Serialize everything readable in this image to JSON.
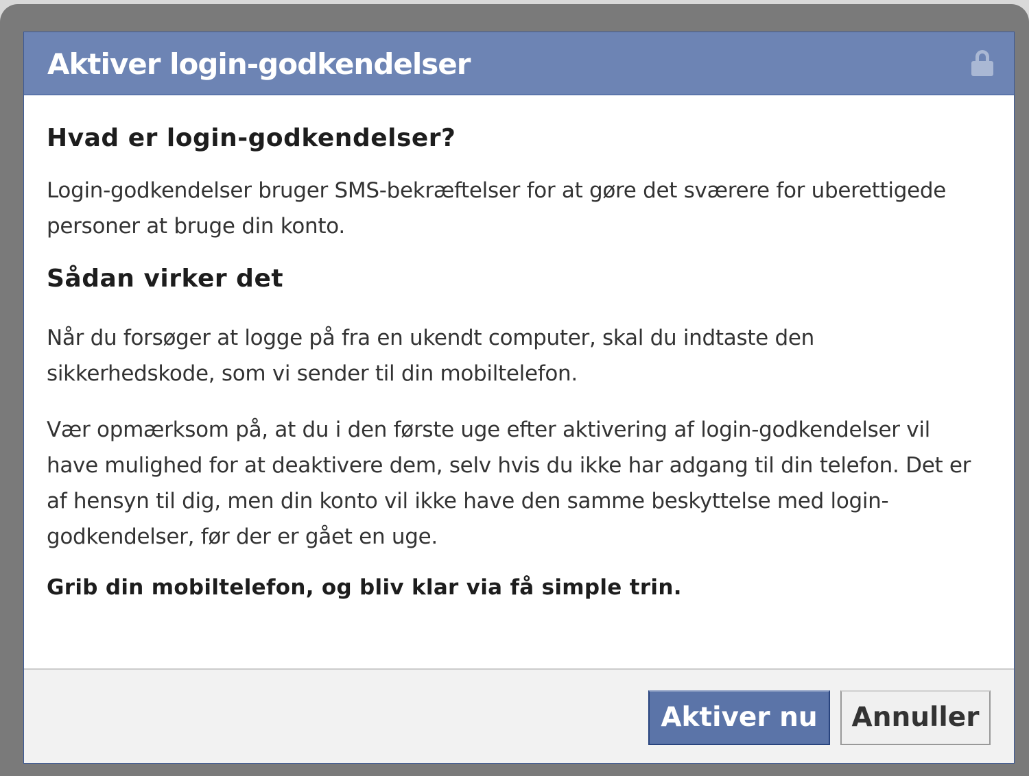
{
  "dialog": {
    "title": "Aktiver login-godkendelser",
    "lock_icon": "lock-icon"
  },
  "content": {
    "heading_1": "Hvad er login-godkendelser?",
    "paragraph_1": "Login-godkendelser bruger SMS-bekræftelser for at gøre det sværere for uberettigede personer at bruge din konto.",
    "heading_2": "Sådan virker det",
    "paragraph_2": "Når du forsøger at logge på fra en ukendt computer, skal du indtaste den sikkerhedskode, som vi sender til din mobiltelefon.",
    "paragraph_3": "Vær opmærksom på, at du i den første uge efter aktivering af login-godkendelser vil have mulighed for at deaktivere dem, selv hvis du ikke har adgang til din telefon. Det er af hensyn til dig, men din konto vil ikke have den samme beskyttelse med login-godkendelser, før der er gået en uge.",
    "paragraph_4": "Grib din mobiltelefon, og bliv klar via få simple trin."
  },
  "footer": {
    "activate_label": "Aktiver nu",
    "cancel_label": "Annuller"
  },
  "colors": {
    "title_bar": "#6d84b4",
    "primary_button": "#5b74a8",
    "frame": "#7a7a7a"
  }
}
